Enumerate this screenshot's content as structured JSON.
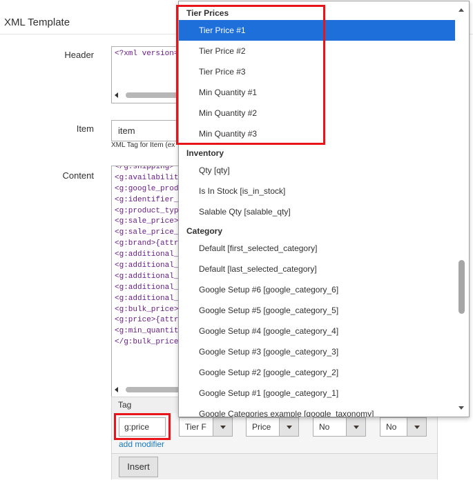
{
  "section": {
    "title": "XML Template"
  },
  "header_field": {
    "label": "Header",
    "value": "<?xml version="
  },
  "item_field": {
    "label": "Item",
    "value": "item",
    "note": "XML Tag for Item (ex"
  },
  "content_field": {
    "label": "Content",
    "lines": [
      "</g:shipping>",
      "<g:availability",
      "<g:google_produ",
      "<g:identifier_e",
      "<g:product_type",
      "<g:sale_price>{",
      "<g:sale_price_e",
      "<g:brand>{attri",
      "<g:additional_i",
      "<g:additional_i",
      "<g:additional_i",
      "<g:additional_i",
      "<g:additional_i",
      "<g:bulk_price>",
      "<g:price>{attri",
      "<g:min_quantity",
      "</g:bulk_price>"
    ]
  },
  "tag_panel": {
    "label": "Tag",
    "tag_value": "g:price",
    "selects": [
      "Tier F",
      "Price",
      "No",
      "No"
    ],
    "add_modifier": "add modifier",
    "insert": "Insert"
  },
  "dropdown": {
    "groups": [
      {
        "label": "Tier Prices",
        "options": [
          "Tier Price #1",
          "Tier Price #2",
          "Tier Price #3",
          "Min Quantity #1",
          "Min Quantity #2",
          "Min Quantity #3"
        ]
      },
      {
        "label": "Inventory",
        "options": [
          "Qty [qty]",
          "Is In Stock [is_in_stock]",
          "Salable Qty [salable_qty]"
        ]
      },
      {
        "label": "Category",
        "options": [
          "Default [first_selected_category]",
          "Default [last_selected_category]",
          "Google Setup #6 [google_category_6]",
          "Google Setup #5 [google_category_5]",
          "Google Setup #4 [google_category_4]",
          "Google Setup #3 [google_category_3]",
          "Google Setup #2 [google_category_2]",
          "Google Setup #1 [google_category_1]",
          "Google Categories example [google_taxonomy]"
        ]
      }
    ],
    "selected": "Tier Price #1"
  },
  "colors": {
    "highlight": "#e8141a",
    "selected_option": "#1e6fd9",
    "link": "#1979c3",
    "code_text": "#6a1b8a"
  }
}
